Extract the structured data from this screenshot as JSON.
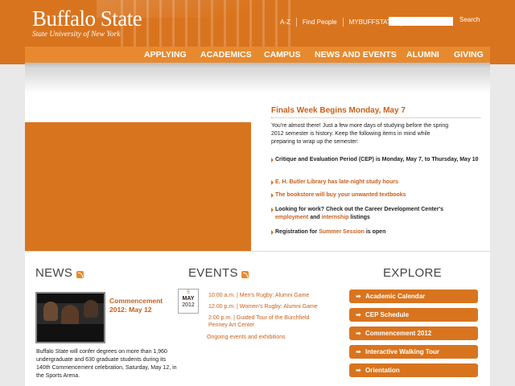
{
  "header": {
    "logo_main": "Buffalo State",
    "logo_sub": "State University of New York",
    "util_links": [
      "A-Z",
      "Find People",
      "MYBUFFSTATE"
    ],
    "search_placeholder": "",
    "search_label": "Search"
  },
  "nav": {
    "items": [
      "APPLYING",
      "ACADEMICS",
      "CAMPUS",
      "NEWS AND EVENTS",
      "ALUMNI",
      "GIVING"
    ]
  },
  "feature": {
    "title": "Finals Week Begins Monday, May 7",
    "intro": "You're almost there! Just a few more days of studying before the spring 2012 semester is history. Keep the following items in mind while preparing to wrap up the semester:",
    "item1": "Critique and Evaluation Period (CEP) is Monday, May 7, to Thursday, May 10",
    "item2": "E. H. Butler Library has late-night study hours",
    "item3": "The bookstore will buy your unwanted textbooks",
    "item4_a": "Looking for work? Check out the Career Development Center's",
    "item4_b": "employment",
    "item4_c": "and",
    "item4_d": "internship",
    "item4_e": "listings",
    "item5_a": "Registration for",
    "item5_b": "Summer Session",
    "item5_c": "is open"
  },
  "news": {
    "heading": "NEWS",
    "title": "Commencement 2012: May 12",
    "text": "Buffalo State will confer degrees on more than 1,960 undergraduate and 630 graduate students during its 140th Commencement celebration, Saturday, May 12, in the Sports Arena."
  },
  "events": {
    "heading": "EVENTS",
    "date_day": "5",
    "date_month": "MAY",
    "date_year": "2012",
    "e1": "10:00 a.m. | Men's Rugby: Alumni Game",
    "e2": "12:00 p.m. | Women's Rugby: Alumni Game",
    "e3": "2:00 p.m. | Guided Tour of the Burchfield Penney Art Center",
    "more": "Ongoing events and exhibitions"
  },
  "explore": {
    "heading": "EXPLORE",
    "links": [
      "Academic Calendar",
      "CEP Schedule",
      "Commencement 2012",
      "Interactive Walking Tour",
      "Orientation"
    ]
  },
  "colors": {
    "brand_orange": "#d9741e",
    "nav_orange": "#e78a2f",
    "link_orange": "#c8601a"
  }
}
